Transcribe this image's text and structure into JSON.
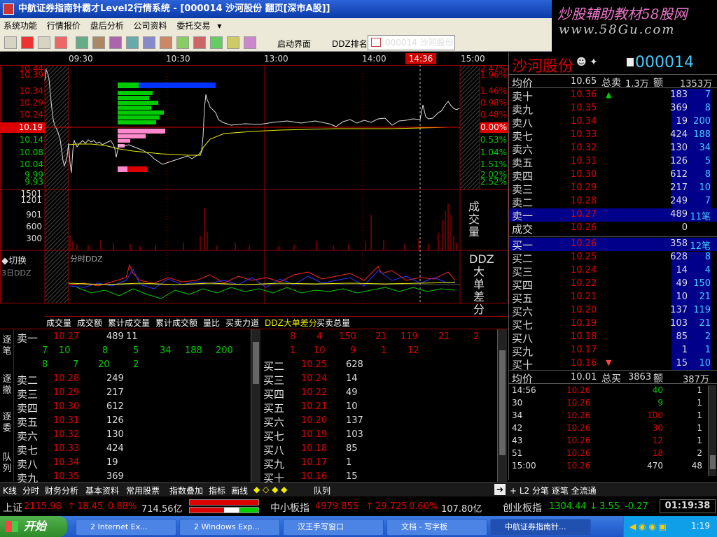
{
  "window": {
    "title": "中航证券指南针霸才Level2行情系统 - [000014 沙河股份 翻页[深市A股]]"
  },
  "watermark": {
    "line1": "炒股辅助教材58股网",
    "line2": "www.58Gu.com"
  },
  "menu": [
    "系统功能",
    "行情报价",
    "盘后分析",
    "公司资料",
    "委托交易"
  ],
  "toolbar": {
    "start_screen": "启动界面",
    "ddz_rank": "DDZ排名",
    "tab_label": "000014 沙河股份"
  },
  "times": [
    "09:30",
    "10:30",
    "13:00",
    "14:00",
    "15:00"
  ],
  "cur_time": "14:36",
  "price_axis": [
    "10.44",
    "10.39",
    "10.34",
    "10.29",
    "10.24",
    "10.19",
    "10.14",
    "10.08",
    "10.04",
    "9.99",
    "9.93"
  ],
  "pct_axis": [
    "2.47%",
    "1.96%",
    "1.46%",
    "0.98%",
    "0.48%",
    "0.00%",
    "0.53%",
    "1.04%",
    "1.51%",
    "2.02%",
    "2.52%"
  ],
  "vol_axis": [
    "1501",
    "1201",
    "901",
    "600",
    "300"
  ],
  "labels": {
    "volume": "成交量",
    "ddz": "DDZ大单差分",
    "switch": "切换",
    "ddz3": "3日DDZ",
    "ddz_chart": "分时DDZ"
  },
  "bottom_tabs": [
    "成交量",
    "成交额",
    "累计成交量",
    "累计成交额",
    "量比",
    "买卖力道",
    "DDZ大单差分",
    "买卖总量"
  ],
  "side_tabs": [
    "逐笔",
    "逐撤",
    "逐委",
    "队列"
  ],
  "queue_left": {
    "top": {
      "label": "卖一",
      "price": "10.27",
      "vol": "489",
      "count": "11"
    },
    "r1": [
      "7",
      "10",
      "8",
      "5",
      "34",
      "188",
      "200"
    ],
    "r2": [
      "8",
      "7",
      "20",
      "2"
    ],
    "rows": [
      {
        "n": "卖二",
        "p": "10.28",
        "v": "249"
      },
      {
        "n": "卖三",
        "p": "10.29",
        "v": "217"
      },
      {
        "n": "卖四",
        "p": "10.30",
        "v": "612"
      },
      {
        "n": "卖五",
        "p": "10.31",
        "v": "126"
      },
      {
        "n": "卖六",
        "p": "10.32",
        "v": "130"
      },
      {
        "n": "卖七",
        "p": "10.33",
        "v": "424"
      },
      {
        "n": "卖八",
        "p": "10.34",
        "v": "19"
      },
      {
        "n": "卖九",
        "p": "10.35",
        "v": "369"
      }
    ]
  },
  "queue_right": {
    "r1": [
      "8",
      "4",
      "150",
      "21",
      "119",
      "21",
      "2"
    ],
    "r2": [
      "1",
      "10",
      "9",
      "1",
      "12"
    ],
    "rows": [
      {
        "n": "买二",
        "p": "10.25",
        "v": "628"
      },
      {
        "n": "买三",
        "p": "10.24",
        "v": "14"
      },
      {
        "n": "买四",
        "p": "10.22",
        "v": "49"
      },
      {
        "n": "买五",
        "p": "10.21",
        "v": "10"
      },
      {
        "n": "买六",
        "p": "10.20",
        "v": "137"
      },
      {
        "n": "买七",
        "p": "10.19",
        "v": "103"
      },
      {
        "n": "买八",
        "p": "10.18",
        "v": "85"
      },
      {
        "n": "买九",
        "p": "10.17",
        "v": "1"
      },
      {
        "n": "买十",
        "p": "10.16",
        "v": "15"
      }
    ]
  },
  "stock": {
    "name": "沙河股份",
    "code": "000014"
  },
  "quote_head": {
    "avg_label": "均价",
    "avg": "10.65",
    "total_sell_label": "总卖",
    "total_sell": "1.3万",
    "amount_label": "额",
    "amount": "1353万"
  },
  "asks": [
    {
      "n": "卖十",
      "p": "10.36",
      "v": "183",
      "c": "7"
    },
    {
      "n": "卖九",
      "p": "10.35",
      "v": "369",
      "c": "8"
    },
    {
      "n": "卖八",
      "p": "10.34",
      "v": "19",
      "c": "200"
    },
    {
      "n": "卖七",
      "p": "10.33",
      "v": "424",
      "c": "188"
    },
    {
      "n": "卖六",
      "p": "10.32",
      "v": "130",
      "c": "34"
    },
    {
      "n": "卖五",
      "p": "10.31",
      "v": "126",
      "c": "5"
    },
    {
      "n": "卖四",
      "p": "10.30",
      "v": "612",
      "c": "8"
    },
    {
      "n": "卖三",
      "p": "10.29",
      "v": "217",
      "c": "10"
    },
    {
      "n": "卖二",
      "p": "10.28",
      "v": "249",
      "c": "7"
    },
    {
      "n": "卖一",
      "p": "10.27",
      "v": "489",
      "c": "11笔"
    }
  ],
  "trade": {
    "n": "成交",
    "p": "10.26",
    "v": "0"
  },
  "bids": [
    {
      "n": "买一",
      "p": "10.26",
      "v": "358",
      "c": "12笔"
    },
    {
      "n": "买二",
      "p": "10.25",
      "v": "628",
      "c": "8"
    },
    {
      "n": "买三",
      "p": "10.24",
      "v": "14",
      "c": "4"
    },
    {
      "n": "买四",
      "p": "10.22",
      "v": "49",
      "c": "150"
    },
    {
      "n": "买五",
      "p": "10.21",
      "v": "10",
      "c": "21"
    },
    {
      "n": "买六",
      "p": "10.20",
      "v": "137",
      "c": "119"
    },
    {
      "n": "买七",
      "p": "10.19",
      "v": "103",
      "c": "21"
    },
    {
      "n": "买八",
      "p": "10.18",
      "v": "85",
      "c": "2"
    },
    {
      "n": "买九",
      "p": "10.17",
      "v": "1",
      "c": "1"
    },
    {
      "n": "买十",
      "p": "10.16",
      "v": "15",
      "c": "10"
    }
  ],
  "quote_foot": {
    "avg_label": "均价",
    "avg": "10.01",
    "total_buy_label": "总买",
    "total_buy": "3863",
    "amount_label": "额",
    "amount": "387万"
  },
  "ticks": [
    {
      "t": "14:56",
      "p": "10.26",
      "v": "40",
      "n": "1"
    },
    {
      "t": "30",
      "p": "10.26",
      "v": "9",
      "n": "1"
    },
    {
      "t": "34",
      "p": "10.26",
      "v": "100",
      "n": "1"
    },
    {
      "t": "42",
      "p": "10.26",
      "v": "30",
      "n": "1"
    },
    {
      "t": "43",
      "p": "10.26",
      "v": "12",
      "n": "1"
    },
    {
      "t": "51",
      "p": "10.26",
      "v": "18",
      "n": "2"
    },
    {
      "t": "15:00",
      "p": "10.26",
      "v": "470",
      "n": "48"
    }
  ],
  "footer": {
    "left_tabs": [
      "K线",
      "分时",
      "财务分析",
      "基本资料",
      "常用股票",
      "指数叠加",
      "指标",
      "画线"
    ],
    "queue": "队列",
    "right": "+ L2 分笔 逐笔 全流通"
  },
  "ticker": {
    "sh_label": "上证",
    "sh": "2115.98",
    "sh_chg": "18.45",
    "sh_pct": "0.88%",
    "sh_amt": "714.56亿",
    "sme_label": "中小板指",
    "sme": "4979.855",
    "sme_chg": "29.725",
    "sme_pct": "0.60%",
    "sme_amt": "107.80亿",
    "gem_label": "创业板指",
    "gem": "1304.44",
    "gem_chg": "3.55",
    "gem_pct": "-0.27",
    "clock": "01:19:38"
  },
  "taskbar": {
    "start": "开始",
    "items": [
      "2 Internet Ex...",
      "2 Windows Exp...",
      "汉王手写窗口",
      "文档 - 写字板",
      "中航证券指南针..."
    ],
    "clock": "1:19"
  }
}
